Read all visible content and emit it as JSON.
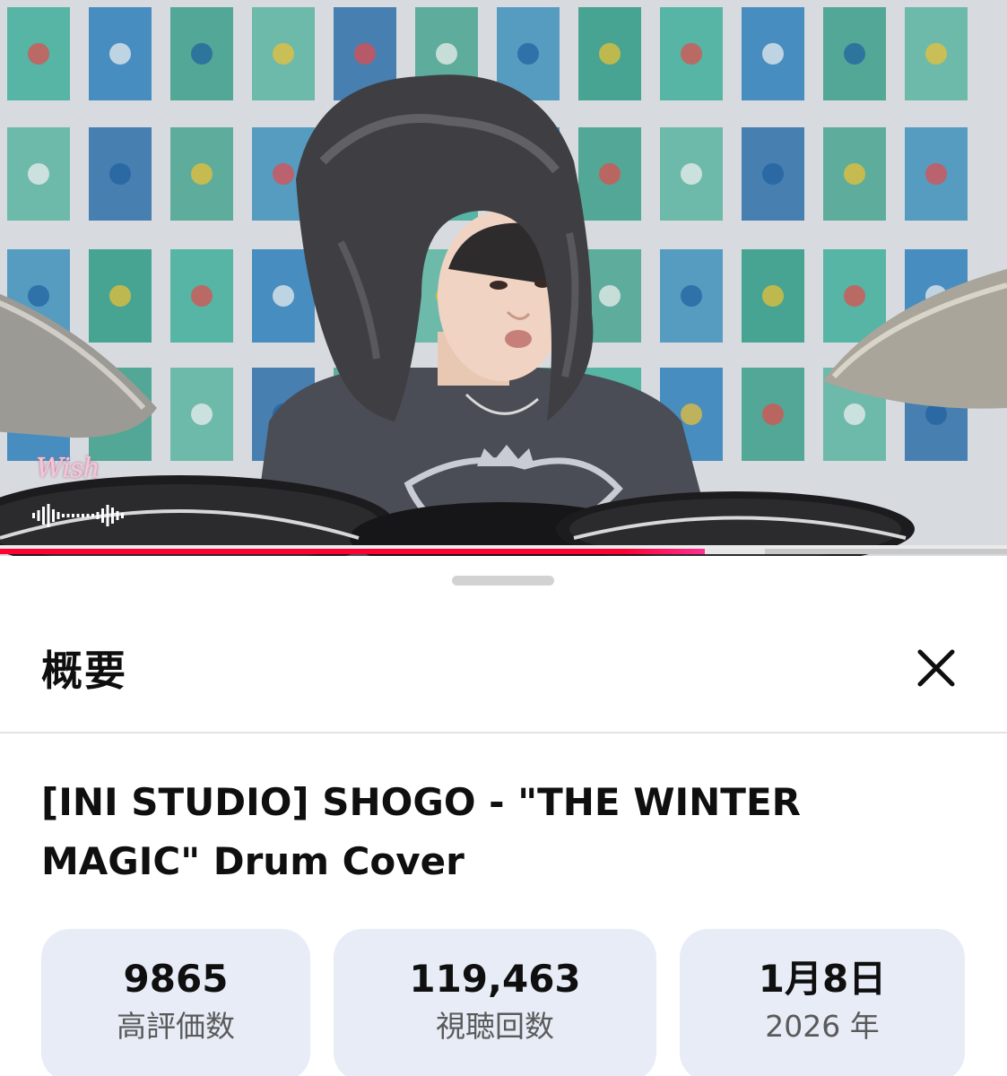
{
  "video": {
    "watermark_text": "Wish",
    "progress_percent": 70
  },
  "sheet": {
    "title": "概要",
    "close_icon": "close-icon",
    "video_title": "[INI STUDIO] SHOGO - \"THE WINTER MAGIC\" Drum Cover",
    "stats": [
      {
        "value": "9865",
        "label": "高評価数"
      },
      {
        "value": "119,463",
        "label": "視聴回数"
      },
      {
        "value": "1月8日",
        "label": "2026 年"
      }
    ]
  },
  "colors": {
    "progress": "#ff0033",
    "stat_background": "#e7ecf6",
    "poster_teal": "#3fae9a"
  }
}
